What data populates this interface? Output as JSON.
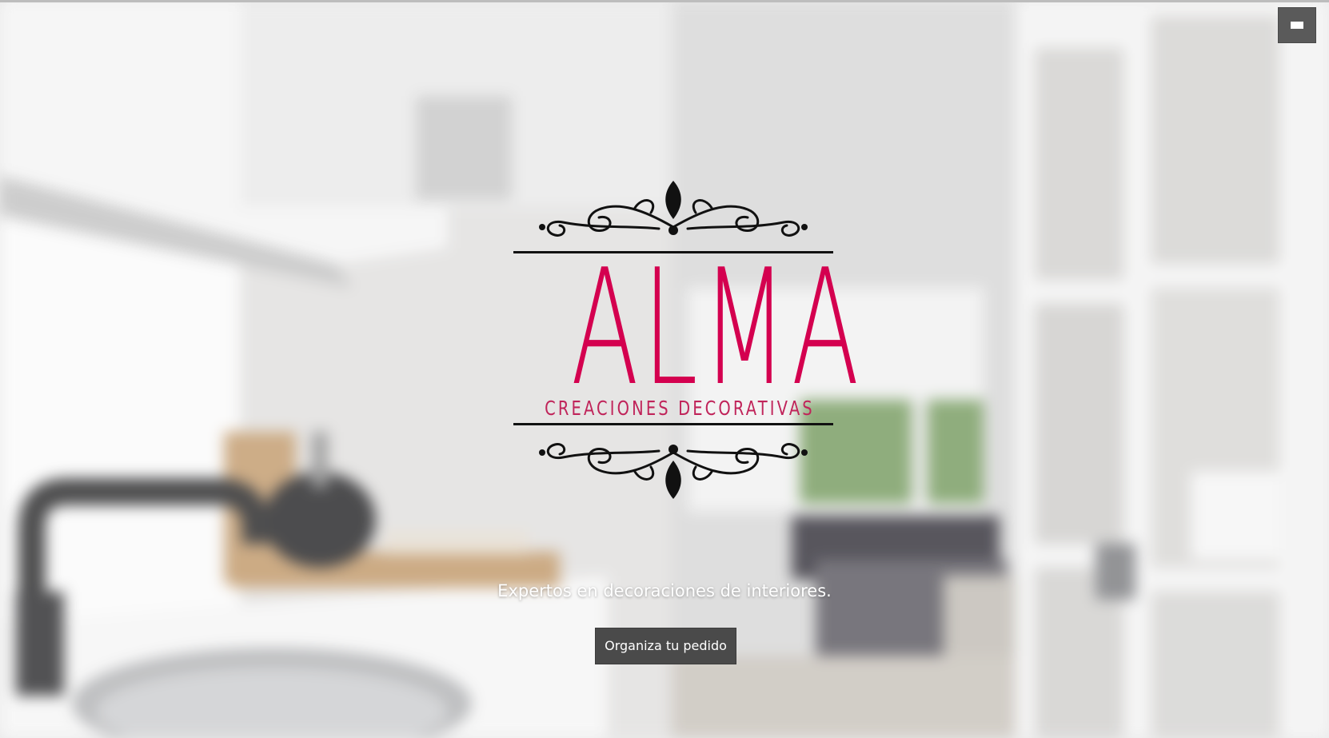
{
  "navigation": {
    "menu_icon": "hamburger-menu-icon"
  },
  "brand": {
    "name": "ALMA",
    "subtitle": "CREACIONES DECORATIVAS",
    "accent_color": "#d4004f"
  },
  "hero": {
    "tagline": "Expertos en decoraciones de interiores.",
    "cta_label": "Organiza tu pedido",
    "background_image": "blurred-kitchen-interior"
  }
}
